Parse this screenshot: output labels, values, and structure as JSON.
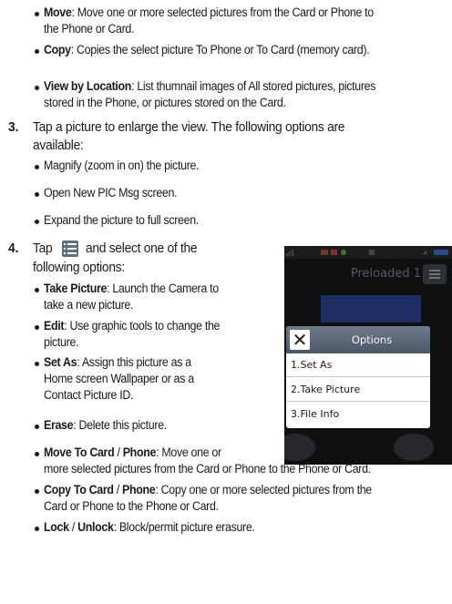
{
  "bullets_top": [
    {
      "term": "Move",
      "text": ": Move one or more selected pictures from the Card or Phone to",
      "cont": "the Phone or Card."
    },
    {
      "term": "Copy",
      "text": ": Copies the select picture To Phone or To Card (memory card).",
      "cont": ""
    },
    {
      "term": "View by Location",
      "text": ": List thumnail images of All stored pictures, pictures",
      "cont": "stored in the Phone, or pictures stored on the Card."
    }
  ],
  "step3": {
    "number": "3.",
    "line1": "Tap a picture to enlarge the view. The following options are",
    "line2": "available:",
    "items": [
      "Magnify (zoom in on) the picture.",
      "Open New PIC Msg screen.",
      "Expand the picture to full screen."
    ]
  },
  "step4": {
    "number": "4.",
    "pre": "Tap",
    "post": "and select one of the",
    "line2": "following options:",
    "menu_icon": "menu-list-icon",
    "items": [
      {
        "term": "Take Picture",
        "lines": [
          ": Launch the Camera to",
          "take a new picture."
        ]
      },
      {
        "term": "Edit",
        "lines": [
          ": Use graphic tools to change the",
          "picture."
        ]
      },
      {
        "term": "Set As",
        "lines": [
          ": Assign this picture as a",
          "Home screen Wallpaper or as a",
          "Contact Picture ID."
        ]
      },
      {
        "term": "Erase",
        "lines": [
          ": Delete this picture."
        ]
      },
      {
        "term": "Move To Card",
        "sep": " / ",
        "term2": "Phone",
        "lines": [
          ": Move one or",
          "more selected pictures from the Card or Phone to the Phone or Card."
        ]
      },
      {
        "term": "Copy To Card",
        "sep": " / ",
        "term2": "Phone",
        "lines": [
          ": Copy one or more selected pictures from the",
          "Card or Phone to the Phone or Card."
        ]
      },
      {
        "term": "Lock",
        "sep": " / ",
        "term2": "Unlock",
        "lines": [
          ": Block/permit picture erasure."
        ]
      }
    ]
  },
  "phone": {
    "title": "Preloaded 1",
    "dialog_title": "Options",
    "close_glyph": "✕",
    "options": [
      "1.Set As",
      "2.Take Picture",
      "3.File Info"
    ],
    "colors": {
      "accent": "#5a6f80",
      "dialog_header": "#56636f",
      "screen_bg": "#0f1012"
    }
  }
}
